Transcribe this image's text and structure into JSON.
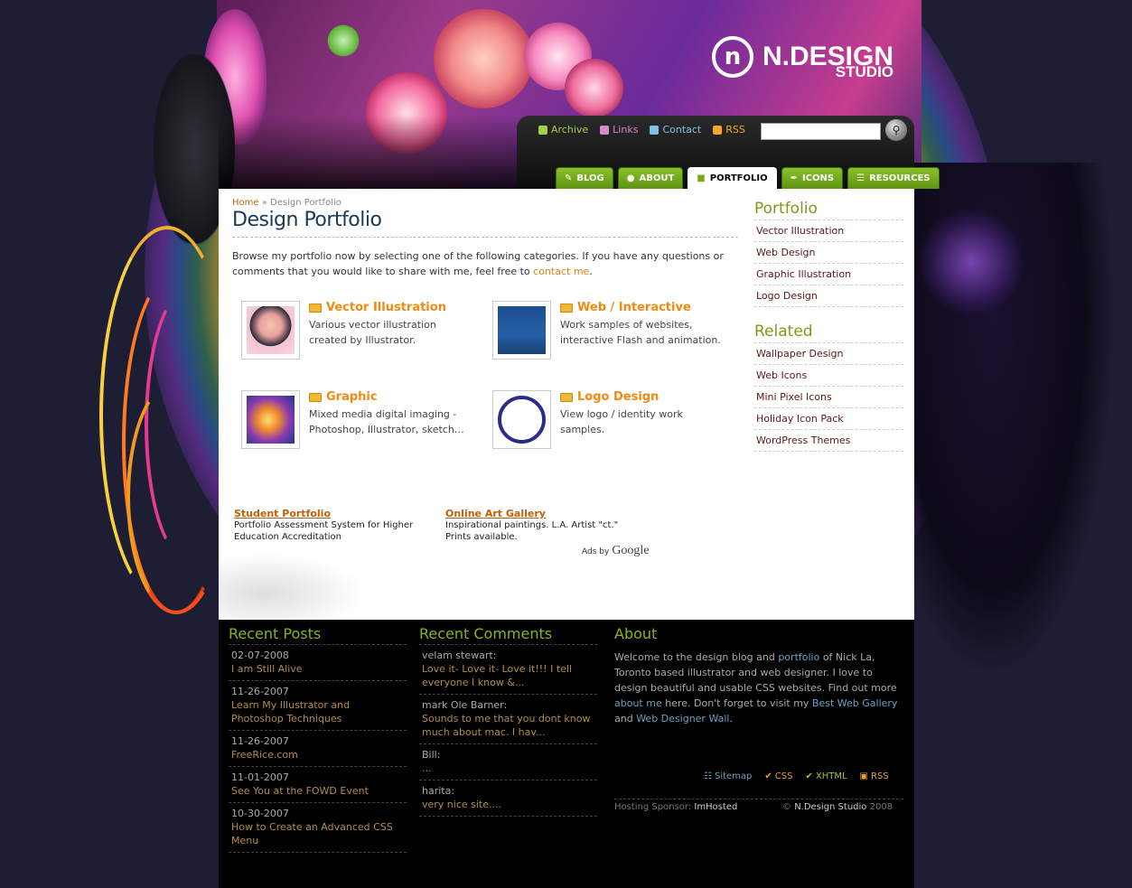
{
  "logo": {
    "mark": "n",
    "name": "N.DESIGN",
    "sub": "STUDIO"
  },
  "toplinks": [
    {
      "label": "Archive",
      "icon": "archive-icon",
      "color": "#9fd14a"
    },
    {
      "label": "Links",
      "icon": "links-icon",
      "color": "#d889c8"
    },
    {
      "label": "Contact",
      "icon": "contact-icon",
      "color": "#7fc0e8"
    },
    {
      "label": "RSS",
      "icon": "rss-icon",
      "color": "#f5a623"
    }
  ],
  "search": {
    "placeholder": ""
  },
  "tabs": [
    {
      "label": "BLOG",
      "icon": "pencil-icon"
    },
    {
      "label": "ABOUT",
      "icon": "person-icon"
    },
    {
      "label": "PORTFOLIO",
      "icon": "briefcase-icon",
      "active": true
    },
    {
      "label": "ICONS",
      "icon": "brush-icon"
    },
    {
      "label": "RESOURCES",
      "icon": "stack-icon"
    }
  ],
  "breadcrumb": {
    "home": "Home",
    "sep": "»",
    "current": "Design Portfolio"
  },
  "page": {
    "title": "Design Portfolio",
    "intro_before": "Browse my portfolio now by selecting one of the following categories. If you have any questions or comments that you would like to share with me, feel free to ",
    "intro_link": "contact me",
    "intro_after": "."
  },
  "categories": [
    {
      "title": "Vector Illustration",
      "desc": "Various vector illustration created by Illustrator.",
      "thumb": "vector-illustration-thumbnail"
    },
    {
      "title": "Web / Interactive",
      "desc": "Work samples of websites, interactive Flash and animation.",
      "thumb": "web-interactive-thumbnail"
    },
    {
      "title": "Graphic",
      "desc": "Mixed media digital imaging - Photoshop, Illustrator, sketch…",
      "thumb": "graphic-thumbnail"
    },
    {
      "title": "Logo Design",
      "desc": "View logo / identity work samples.",
      "thumb": "logo-design-thumbnail"
    }
  ],
  "ads": [
    {
      "title": "Student Portfolio",
      "text": "Portfolio Assessment System for Higher Education Accreditation"
    },
    {
      "title": "Online Art Gallery",
      "text": "Inspirational paintings. L.A. Artist \"ct.\" Prints available."
    }
  ],
  "ads_by": {
    "prefix": "Ads by",
    "brand": "Google"
  },
  "sidebar": {
    "portfolio_title": "Portfolio",
    "portfolio": [
      "Vector Illustration",
      "Web Design",
      "Graphic Illustration",
      "Logo Design"
    ],
    "related_title": "Related",
    "related": [
      "Wallpaper Design",
      "Web Icons",
      "Mini Pixel Icons",
      "Holiday Icon Pack",
      "WordPress Themes"
    ]
  },
  "footer": {
    "recent_posts_title": "Recent Posts",
    "recent_posts": [
      {
        "date": "02-07-2008",
        "title": "I am Still Alive"
      },
      {
        "date": "11-26-2007",
        "title": "Learn My Illustrator and Photoshop Techniques"
      },
      {
        "date": "11-26-2007",
        "title": "FreeRice.com"
      },
      {
        "date": "11-01-2007",
        "title": "See You at the FOWD Event"
      },
      {
        "date": "10-30-2007",
        "title": "How to Create an Advanced CSS Menu"
      }
    ],
    "recent_comments_title": "Recent Comments",
    "recent_comments": [
      {
        "author": "velam stewart:",
        "text": "Love it- Love it- Love it!!! I tell everyone I know &..."
      },
      {
        "author": "mark Ole Barner:",
        "text": "Sounds to me that you dont know much about mac. I hav..."
      },
      {
        "author": "Bill:",
        "text": "..."
      },
      {
        "author": "harita:",
        "text": "very nice site...."
      }
    ],
    "about_title": "About",
    "about": {
      "t1": "Welcome to the design blog and ",
      "l1": "portfolio",
      "t2": " of Nick La, Toronto based illustrator and web designer. I love to design beautiful and usable CSS websites. Find out more ",
      "l2": "about me",
      "t3": " here. Don't forget to visit my ",
      "l3": "Best Web Gallery",
      "t4": " and ",
      "l4": "Web Designer Wall",
      "t5": "."
    },
    "links": [
      {
        "label": "Sitemap",
        "icon": "sitemap-icon",
        "color": "#6aa0c0"
      },
      {
        "label": "CSS",
        "icon": "check-icon",
        "color": "#e8a030"
      },
      {
        "label": "XHTML",
        "icon": "check-icon",
        "color": "#9ac830"
      },
      {
        "label": "RSS",
        "icon": "rss-icon",
        "color": "#e8a030"
      }
    ],
    "hosting_label": "Hosting Sponsor:",
    "hosting_name": "ImHosted",
    "copy_symbol": "©",
    "copy_name": "N.Design Studio",
    "copy_year": "2008"
  }
}
